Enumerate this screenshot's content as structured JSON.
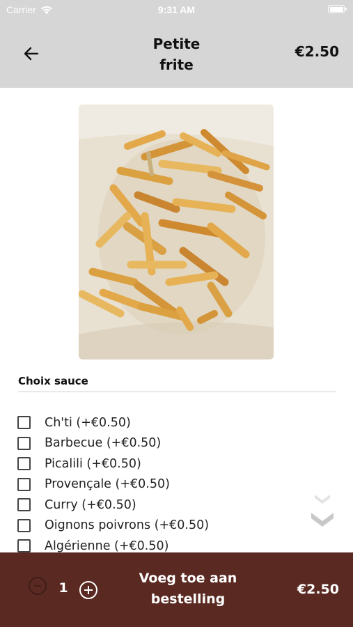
{
  "status_bar": {
    "carrier": "Carrier",
    "time": "9:31 AM"
  },
  "header": {
    "title_line1": "Petite",
    "title_line2": "frite",
    "price": "€2.50"
  },
  "product": {
    "image_icon": "fries-photo"
  },
  "options": {
    "section_title": "Choix sauce",
    "items": [
      {
        "label": "Ch'ti (+€0.50)",
        "checked": false
      },
      {
        "label": "Barbecue (+€0.50)",
        "checked": false
      },
      {
        "label": "Picalili (+€0.50)",
        "checked": false
      },
      {
        "label": "Provençale (+€0.50)",
        "checked": false
      },
      {
        "label": "Curry (+€0.50)",
        "checked": false
      },
      {
        "label": "Oignons poivrons (+€0.50)",
        "checked": false
      },
      {
        "label": "Algérienne (+€0.50)",
        "checked": false
      }
    ]
  },
  "footer": {
    "quantity": "1",
    "add_label_line1": "Voeg toe aan",
    "add_label_line2": "bestelling",
    "price": "€2.50"
  },
  "colors": {
    "header_bg": "#d6d6d6",
    "footer_bg": "#5a2a22",
    "text": "#111111"
  }
}
